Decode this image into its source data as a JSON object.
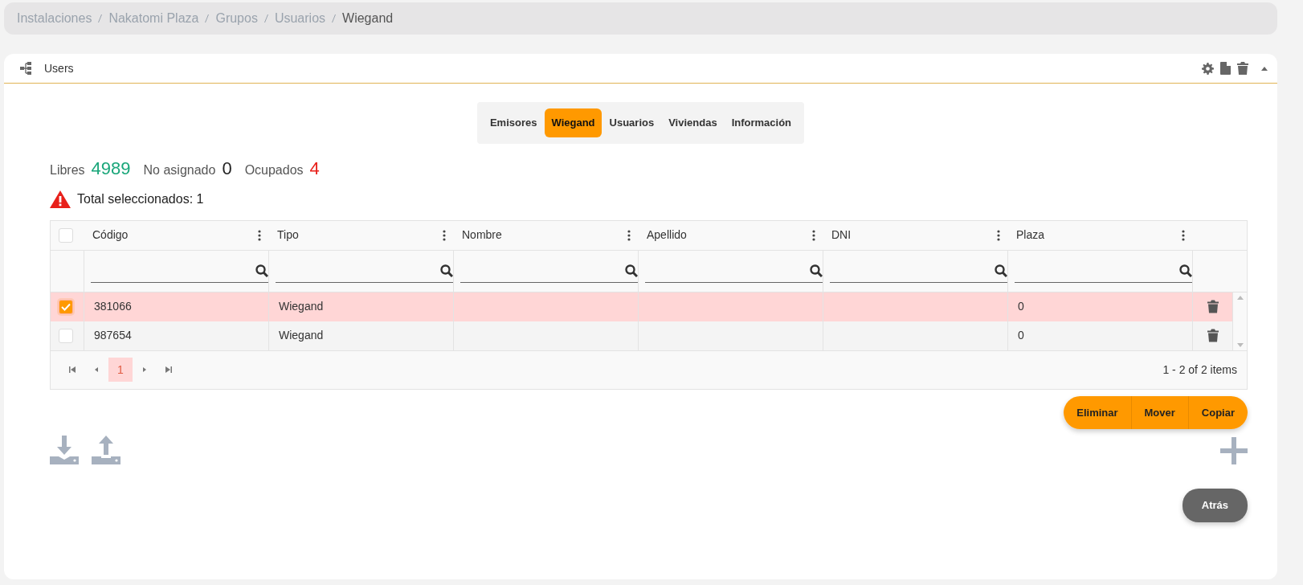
{
  "breadcrumb": [
    {
      "label": "Instalaciones",
      "active": false
    },
    {
      "label": "Nakatomi Plaza",
      "active": false
    },
    {
      "label": "Grupos",
      "active": false
    },
    {
      "label": "Usuarios",
      "active": false
    },
    {
      "label": "Wiegand",
      "active": true
    }
  ],
  "panel": {
    "title": "Users"
  },
  "tabs": [
    {
      "label": "Emisores",
      "selected": false
    },
    {
      "label": "Wiegand",
      "selected": true
    },
    {
      "label": "Usuarios",
      "selected": false
    },
    {
      "label": "Viviendas",
      "selected": false
    },
    {
      "label": "Información",
      "selected": false
    }
  ],
  "stats": [
    {
      "label": "Libres",
      "value": "4989",
      "color": "#1aa67a"
    },
    {
      "label": "No asignado",
      "value": "0",
      "color": "#222222"
    },
    {
      "label": "Ocupados",
      "value": "4",
      "color": "#e8201a"
    }
  ],
  "warning": "Total seleccionados: 1",
  "table": {
    "select_all": {
      "checked": false
    },
    "columns": [
      "Código",
      "Tipo",
      "Nombre",
      "Apellido",
      "DNI",
      "Plaza"
    ],
    "rows": [
      {
        "checked": true,
        "cells": [
          "381066",
          "Wiegand",
          "",
          "",
          "",
          "0"
        ]
      },
      {
        "checked": false,
        "cells": [
          "987654",
          "Wiegand",
          "",
          "",
          "",
          "0"
        ]
      }
    ],
    "pages": [
      {
        "label": "1",
        "selected": true
      }
    ],
    "summary": "1 - 2 of 2 items"
  },
  "actions": [
    "Eliminar",
    "Mover",
    "Copiar"
  ],
  "back_button": "Atrás"
}
